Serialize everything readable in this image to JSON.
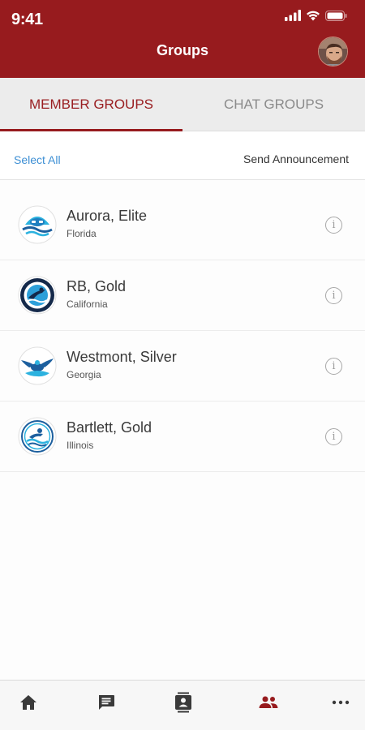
{
  "status": {
    "time": "9:41"
  },
  "header": {
    "title": "Groups"
  },
  "tabs": [
    {
      "label": "MEMBER GROUPS",
      "active": true
    },
    {
      "label": "CHAT GROUPS",
      "active": false
    }
  ],
  "actions": {
    "select_all": "Select All",
    "send_announcement": "Send Announcement"
  },
  "groups": [
    {
      "name": "Aurora, Elite",
      "location": "Florida"
    },
    {
      "name": "RB, Gold",
      "location": "California"
    },
    {
      "name": "Westmont, Silver",
      "location": "Georgia"
    },
    {
      "name": "Bartlett, Gold",
      "location": "Illinois"
    }
  ],
  "bottom_nav": [
    {
      "icon": "home-icon"
    },
    {
      "icon": "chat-icon"
    },
    {
      "icon": "contacts-icon"
    },
    {
      "icon": "groups-icon",
      "active": true
    },
    {
      "icon": "more-icon"
    }
  ],
  "colors": {
    "brand": "#971b1e",
    "link": "#3d8fd4",
    "active_tab": "#9a1f22"
  }
}
